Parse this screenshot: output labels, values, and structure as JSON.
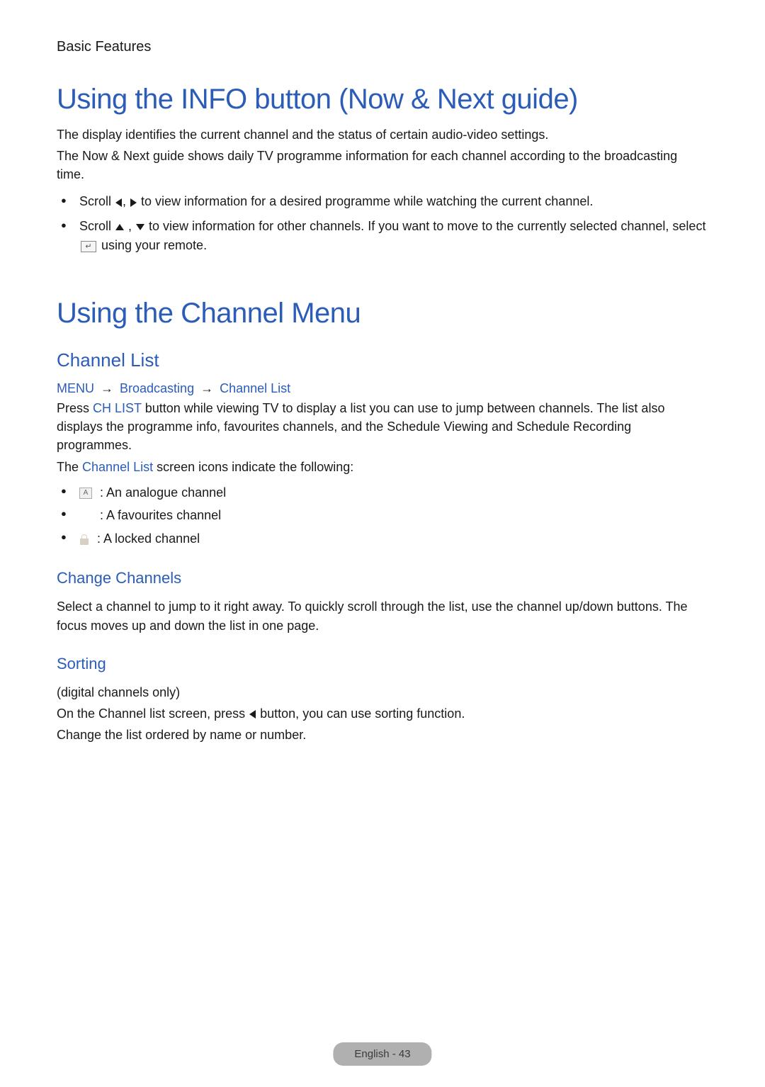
{
  "section_label": "Basic Features",
  "heading1": "Using the INFO button (Now & Next guide)",
  "intro": {
    "line1": "The display identifies the current channel and the status of certain audio-video settings.",
    "line2": "The Now & Next guide shows daily TV programme information for each channel according to the broadcasting time."
  },
  "scroll_bullets": {
    "item1_pre": "Scroll ",
    "item1_mid": ", ",
    "item1_post": " to view information for a desired programme while watching the current channel.",
    "item2_pre": "Scroll ",
    "item2_mid": " , ",
    "item2_post": " to view information for other channels. If you want to move to the currently selected channel, select ",
    "item2_tail": " using your remote."
  },
  "heading2": "Using the Channel Menu",
  "channel_list": {
    "title": "Channel List",
    "nav": {
      "menu": "MENU",
      "broadcasting": "Broadcasting",
      "channel_list": "Channel List"
    },
    "para_prefix": "Press ",
    "para_chlist": "CH LIST",
    "para_suffix": " button while viewing TV to display a list you can use to jump between channels. The list also displays the programme info, favourites channels, and the Schedule Viewing and Schedule Recording programmes.",
    "icons_intro_pre": "The ",
    "icons_intro_blue": "Channel List",
    "icons_intro_post": " screen icons indicate the following:",
    "icon_items": {
      "analogue_letter": "A",
      "analogue": " : An analogue channel",
      "favourites": " : A favourites channel",
      "locked": " : A locked channel"
    }
  },
  "change_channels": {
    "title": "Change Channels",
    "body": "Select a channel to jump to it right away. To quickly scroll through the list, use the channel up/down buttons. The focus moves up and down the list in one page."
  },
  "sorting": {
    "title": "Sorting",
    "line1": "(digital channels only)",
    "line2_pre": "On the Channel list screen, press ",
    "line2_post": " button, you can use sorting function.",
    "line3": "Change the list ordered by name or number."
  },
  "footer": "English - 43"
}
